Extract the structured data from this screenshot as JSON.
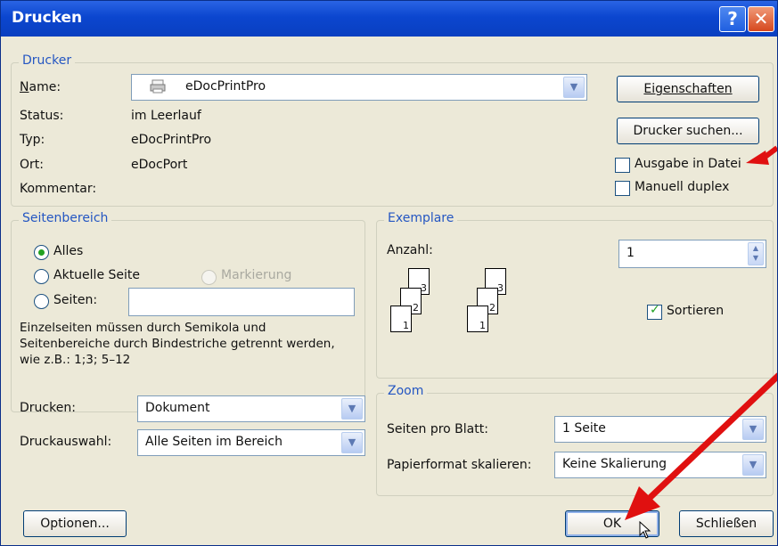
{
  "window": {
    "title": "Drucken",
    "help_glyph": "?",
    "close_glyph": "✕"
  },
  "printer": {
    "legend": "Drucker",
    "name_label": "Name:",
    "name_value": "eDocPrintPro",
    "status_label": "Status:",
    "status_value": "im Leerlauf",
    "type_label": "Typ:",
    "type_value": "eDocPrintPro",
    "location_label": "Ort:",
    "location_value": "eDocPort",
    "comment_label": "Kommentar:",
    "properties_button": "Eigenschaften",
    "find_printer_button": "Drucker suchen...",
    "print_to_file": {
      "label": "Ausgabe in Datei",
      "checked": false
    },
    "manual_duplex": {
      "label": "Manuell duplex",
      "checked": false
    }
  },
  "page_range": {
    "legend": "Seitenbereich",
    "all": {
      "label": "Alles",
      "selected": true
    },
    "current": {
      "label": "Aktuelle Seite"
    },
    "selection": {
      "label": "Markierung",
      "disabled": true
    },
    "pages": {
      "label": "Seiten:",
      "value": ""
    },
    "hint": "Einzelseiten müssen durch Semikola und Seitenbereiche durch Bindestriche getrennt werden, wie z.B.: 1;3; 5–12"
  },
  "copies": {
    "legend": "Exemplare",
    "count_label": "Anzahl:",
    "count_value": "1",
    "collate": {
      "label": "Sortieren",
      "checked": true
    },
    "page_numbers": [
      "1",
      "2",
      "3"
    ]
  },
  "print_what": {
    "label": "Drucken:",
    "value": "Dokument"
  },
  "print_selection": {
    "label": "Druckauswahl:",
    "value": "Alle Seiten im Bereich"
  },
  "zoom": {
    "legend": "Zoom",
    "pages_per_sheet_label": "Seiten pro Blatt:",
    "pages_per_sheet_value": "1 Seite",
    "scale_label": "Papierformat skalieren:",
    "scale_value": "Keine Skalierung"
  },
  "footer": {
    "options_button": "Optionen...",
    "ok_button": "OK",
    "close_button": "Schließen"
  },
  "colors": {
    "title_bar": "#0b46cf",
    "legend_text": "#2456c2",
    "annotation_arrow": "#e01010",
    "check_green": "#21a121"
  }
}
